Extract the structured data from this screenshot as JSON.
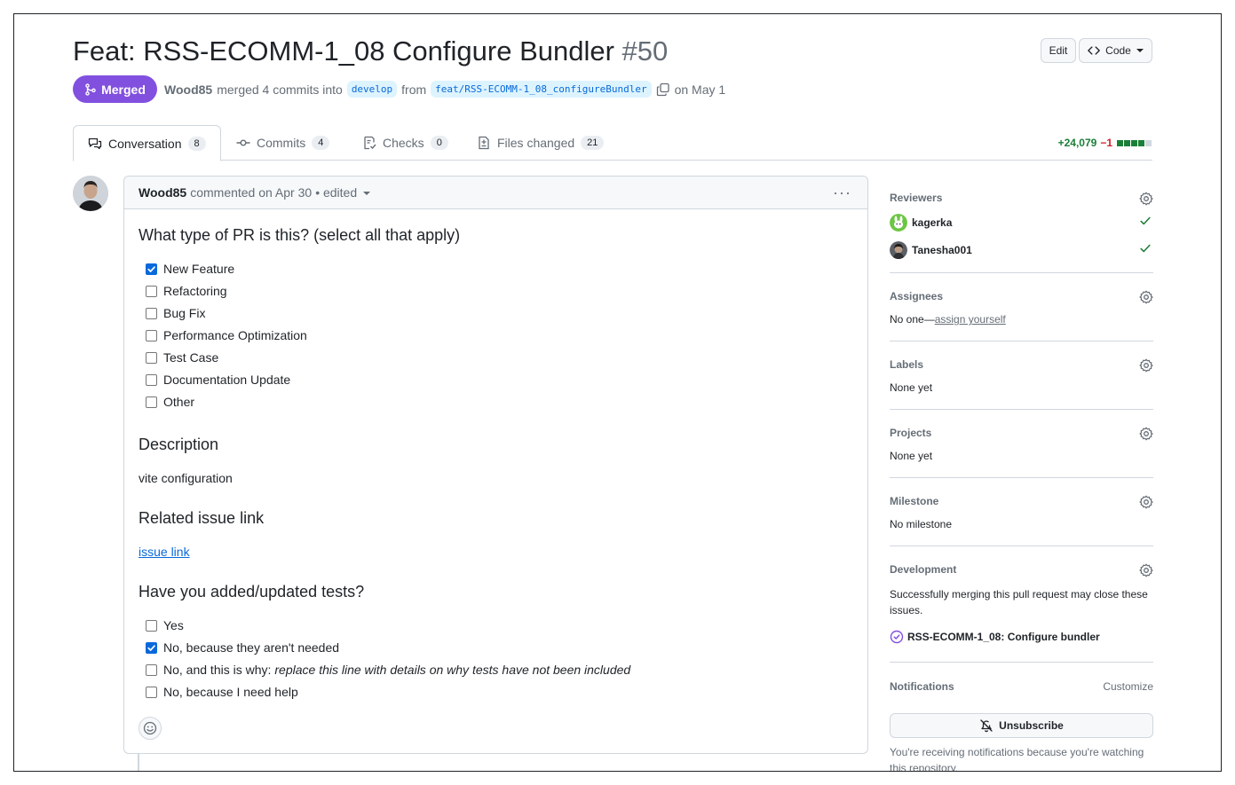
{
  "pr": {
    "title": "Feat: RSS-ECOMM-1_08 Configure Bundler",
    "number": "#50",
    "state": "Merged",
    "author": "Wood85",
    "merge_text": "merged 4 commits into",
    "base_branch": "develop",
    "from_text": "from",
    "head_branch": "feat/RSS-ECOMM-1_08_configureBundler",
    "date_text": "on May 1"
  },
  "header": {
    "edit_label": "Edit",
    "code_label": "Code"
  },
  "tabs": [
    {
      "label": "Conversation",
      "count": "8"
    },
    {
      "label": "Commits",
      "count": "4"
    },
    {
      "label": "Checks",
      "count": "0"
    },
    {
      "label": "Files changed",
      "count": "21"
    }
  ],
  "diffstat": {
    "additions": "+24,079",
    "deletions": "−1"
  },
  "comment": {
    "author": "Wood85",
    "meta": "commented on Apr 30",
    "edited": "• edited",
    "heading_type": "What type of PR is this? (select all that apply)",
    "type_options": [
      {
        "label": "New Feature",
        "checked": true
      },
      {
        "label": "Refactoring",
        "checked": false
      },
      {
        "label": "Bug Fix",
        "checked": false
      },
      {
        "label": "Performance Optimization",
        "checked": false
      },
      {
        "label": "Test Case",
        "checked": false
      },
      {
        "label": "Documentation Update",
        "checked": false
      },
      {
        "label": "Other",
        "checked": false
      }
    ],
    "heading_description": "Description",
    "description": "vite configuration",
    "heading_issue": "Related issue link",
    "issue_link": "issue link",
    "heading_tests": "Have you added/updated tests?",
    "test_options": [
      {
        "label": "Yes",
        "checked": false
      },
      {
        "label": "No, because they aren't needed",
        "checked": true
      },
      {
        "label": "No, and this is why:",
        "italic": "replace this line with details on why tests have not been included",
        "checked": false
      },
      {
        "label": "No, because I need help",
        "checked": false
      }
    ]
  },
  "sidebar": {
    "reviewers_title": "Reviewers",
    "reviewers": [
      {
        "name": "kagerka"
      },
      {
        "name": "Tanesha001"
      }
    ],
    "assignees_title": "Assignees",
    "assignees_none": "No one—",
    "assign_yourself": "assign yourself",
    "labels_title": "Labels",
    "labels_value": "None yet",
    "projects_title": "Projects",
    "projects_value": "None yet",
    "milestone_title": "Milestone",
    "milestone_value": "No milestone",
    "development_title": "Development",
    "development_text": "Successfully merging this pull request may close these issues.",
    "linked_issue": "RSS-ECOMM-1_08: Configure bundler",
    "notifications_title": "Notifications",
    "customize_label": "Customize",
    "unsubscribe_label": "Unsubscribe",
    "notifications_text": "You're receiving notifications because you're watching this repository."
  },
  "colors": {
    "merged": "#8250df",
    "link": "#0969da",
    "success": "#1a7f37",
    "danger": "#cf222e"
  }
}
